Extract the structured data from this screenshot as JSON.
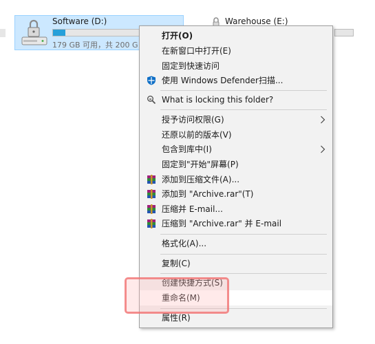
{
  "drives": [
    {
      "name": "Software (D:)",
      "free_text": "179 GB 可用，共 200 G",
      "used_fraction": 0.14,
      "selected": true
    },
    {
      "name": "Warehouse (E:)"
    }
  ],
  "menu": {
    "items": [
      {
        "label": "打开(O)",
        "bold": true
      },
      {
        "label": "在新窗口中打开(E)"
      },
      {
        "label": "固定到快速访问"
      },
      {
        "label": "使用 Windows Defender扫描...",
        "icon": "windows-defender-icon"
      },
      {
        "label": "What is locking this folder?",
        "icon": "lock-search-icon"
      },
      {
        "label": "授予访问权限(G)",
        "submenu": true
      },
      {
        "label": "还原以前的版本(V)"
      },
      {
        "label": "包含到库中(I)",
        "submenu": true
      },
      {
        "label": "固定到\"开始\"屏幕(P)"
      },
      {
        "label": "添加到压缩文件(A)...",
        "icon": "winrar-icon"
      },
      {
        "label": "添加到 \"Archive.rar\"(T)",
        "icon": "winrar-icon"
      },
      {
        "label": "压缩并 E-mail...",
        "icon": "winrar-icon"
      },
      {
        "label": "压缩到 \"Archive.rar\" 并 E-mail",
        "icon": "winrar-icon"
      },
      {
        "label": "格式化(A)..."
      },
      {
        "label": "复制(C)"
      },
      {
        "label": "创建快捷方式(S)"
      },
      {
        "label": "重命名(M)",
        "hovered": true
      },
      {
        "label": "属性(R)"
      }
    ]
  },
  "colors": {
    "menu_bg": "#f2f2f2",
    "selection_bg": "#cce8ff",
    "progress_fill": "#26a0da",
    "defender_blue": "#0f6fc6",
    "highlight_red": "#f06e6e"
  }
}
